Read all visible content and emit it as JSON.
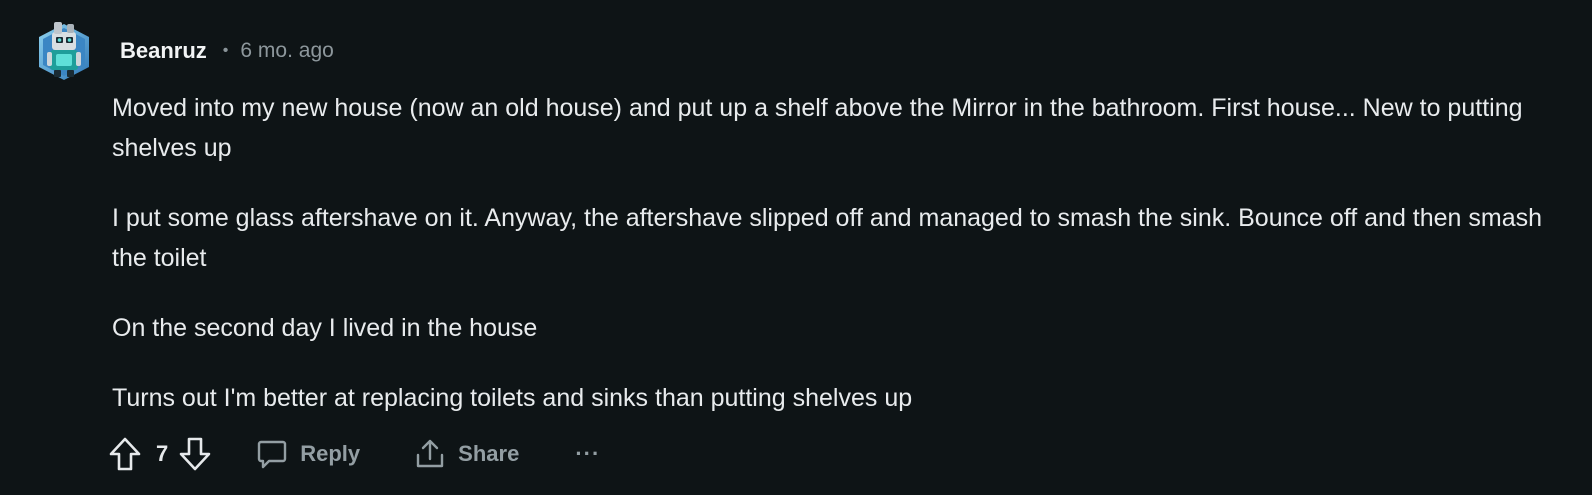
{
  "comment": {
    "author": "Beanruz",
    "separator": "•",
    "time_ago": "6 mo. ago",
    "paragraphs": [
      "Moved into my new house (now an old house) and put up a shelf above the Mirror in the bathroom. First house... New to putting shelves up",
      "I put some glass aftershave on it. Anyway, the aftershave slipped off and managed to smash the sink. Bounce off and then smash the toilet",
      "On the second day I lived in the house",
      "Turns out I'm better at replacing toilets and sinks than putting shelves up"
    ]
  },
  "actions": {
    "vote_count": "7",
    "reply_label": "Reply",
    "share_label": "Share",
    "more_label": "···"
  },
  "icons": {
    "upvote": "arrow-up-outline",
    "downvote": "arrow-down-outline",
    "reply": "speech-bubble",
    "share": "upload-arrow",
    "more": "ellipsis"
  },
  "colors": {
    "background": "#0e1416",
    "text": "#e8ebed",
    "muted": "#939ea3",
    "avatar_frame": "#5a9fd4"
  }
}
